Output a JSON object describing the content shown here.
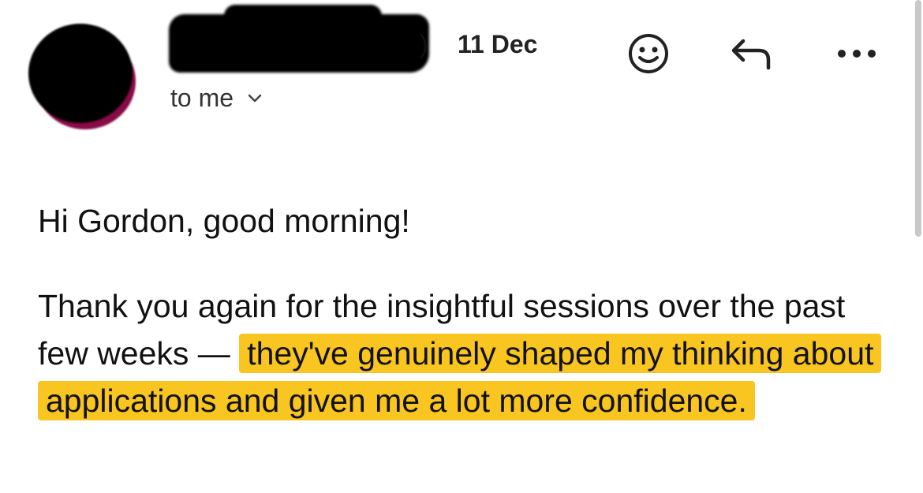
{
  "header": {
    "sender_suffix": ")",
    "date": "11 Dec",
    "recipient_label": "to me"
  },
  "icons": {
    "emoji": "smiley-face-icon",
    "reply": "reply-arrow-icon",
    "more": "more-options-icon",
    "recipient_toggle": "chevron-down-icon"
  },
  "message": {
    "greeting": "Hi Gordon, good morning!",
    "body_plain": "Thank you again for the insightful sessions over the past few weeks — ",
    "body_highlighted": "they've genuinely shaped my thinking about applications and given me a lot more confidence."
  },
  "colors": {
    "highlight": "#f9c520",
    "redaction": "#000000"
  }
}
